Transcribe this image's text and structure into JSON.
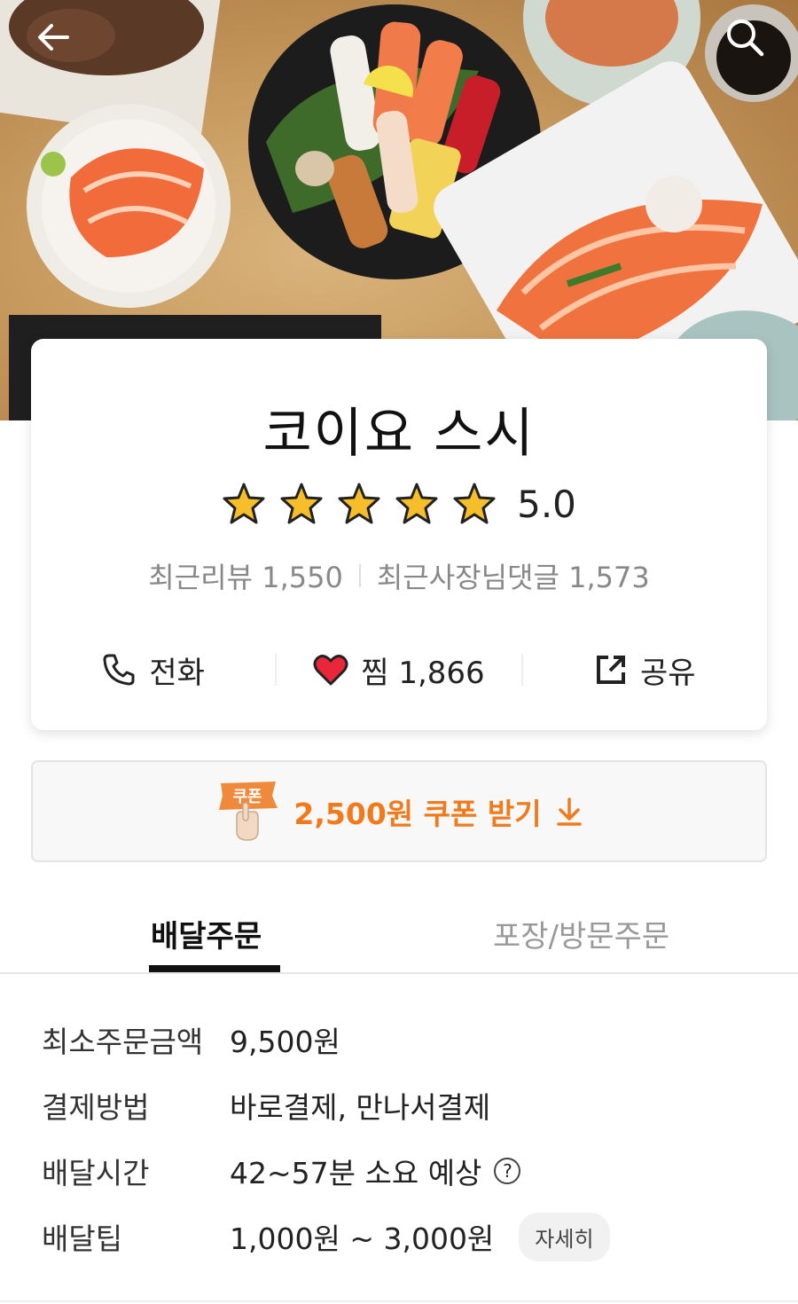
{
  "header": {
    "back_icon": "back-arrow-icon",
    "search_icon": "search-icon"
  },
  "store": {
    "name": "코이요 스시",
    "rating": "5.0",
    "star_count": 5,
    "recent_reviews": "최근리뷰 1,550",
    "recent_owner_replies": "최근사장님댓글 1,573"
  },
  "actions": {
    "call_label": "전화",
    "wish_label": "찜 1,866",
    "share_label": "공유"
  },
  "coupon": {
    "badge": "쿠폰",
    "text": "2,500원 쿠폰 받기",
    "color": "#f07a1c"
  },
  "tabs": [
    {
      "label": "배달주문",
      "active": true
    },
    {
      "label": "포장/방문주문",
      "active": false
    }
  ],
  "info": {
    "min_order_label": "최소주문금액",
    "min_order_value": "9,500원",
    "payment_label": "결제방법",
    "payment_value": "바로결제, 만나서결제",
    "delivery_time_label": "배달시간",
    "delivery_time_value": "42~57분 소요 예상",
    "delivery_tip_label": "배달팁",
    "delivery_tip_value": "1,000원 ~ 3,000원",
    "detail_button": "자세히"
  }
}
